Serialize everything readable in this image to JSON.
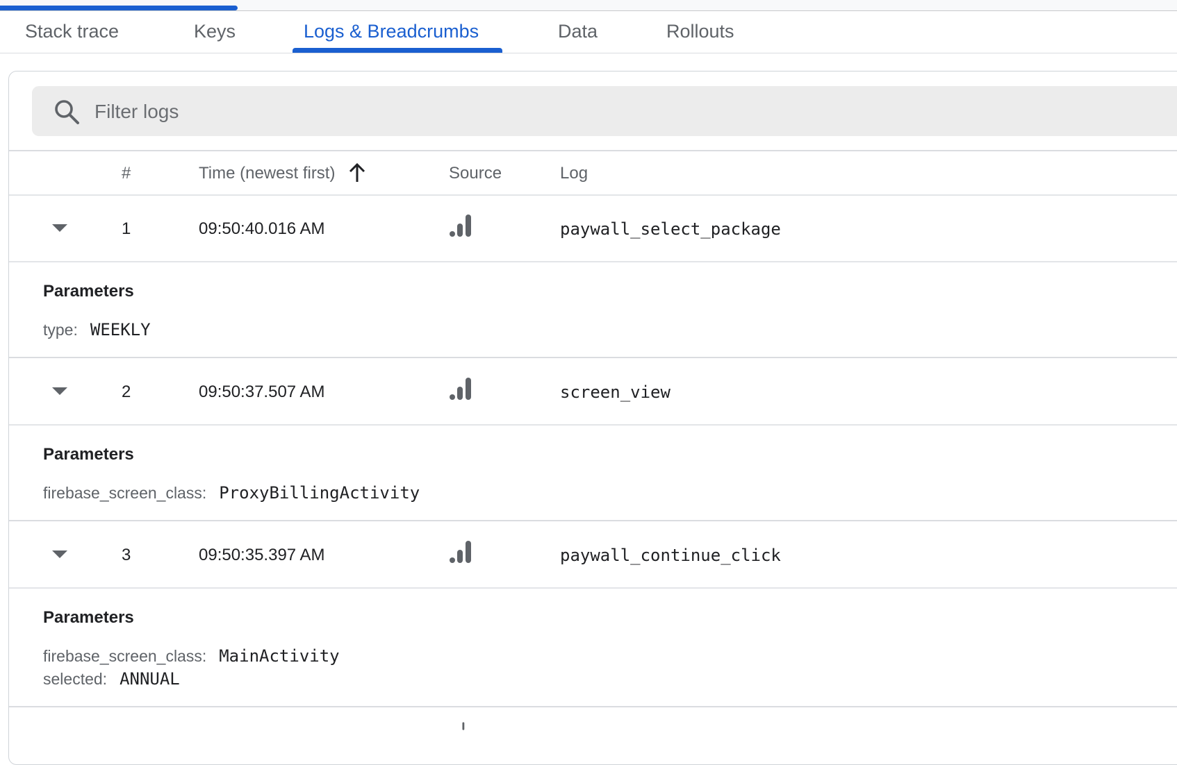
{
  "colors": {
    "accent": "#1a5fd0",
    "icon_gray": "#5f6368",
    "divider": "#dadce0"
  },
  "tabs": [
    {
      "label": "Stack trace",
      "active": false
    },
    {
      "label": "Keys",
      "active": false
    },
    {
      "label": "Logs & Breadcrumbs",
      "active": true
    },
    {
      "label": "Data",
      "active": false
    },
    {
      "label": "Rollouts",
      "active": false
    }
  ],
  "search": {
    "placeholder": "Filter logs",
    "value": "",
    "icon": "search-icon"
  },
  "table": {
    "headers": {
      "index": "#",
      "time": "Time (newest first)",
      "source": "Source",
      "log": "Log"
    },
    "sort_icon": "arrow-up-icon",
    "params_title": "Parameters",
    "rows": [
      {
        "index": "1",
        "time": "09:50:40.016 AM",
        "source_icon": "analytics-icon",
        "log": "paywall_select_package",
        "params": [
          {
            "key": "type:",
            "value": "WEEKLY"
          }
        ]
      },
      {
        "index": "2",
        "time": "09:50:37.507 AM",
        "source_icon": "analytics-icon",
        "log": "screen_view",
        "params": [
          {
            "key": "firebase_screen_class:",
            "value": "ProxyBillingActivity"
          }
        ]
      },
      {
        "index": "3",
        "time": "09:50:35.397 AM",
        "source_icon": "analytics-icon",
        "log": "paywall_continue_click",
        "params": [
          {
            "key": "firebase_screen_class:",
            "value": "MainActivity"
          },
          {
            "key": "selected:",
            "value": "ANNUAL"
          }
        ]
      }
    ]
  }
}
